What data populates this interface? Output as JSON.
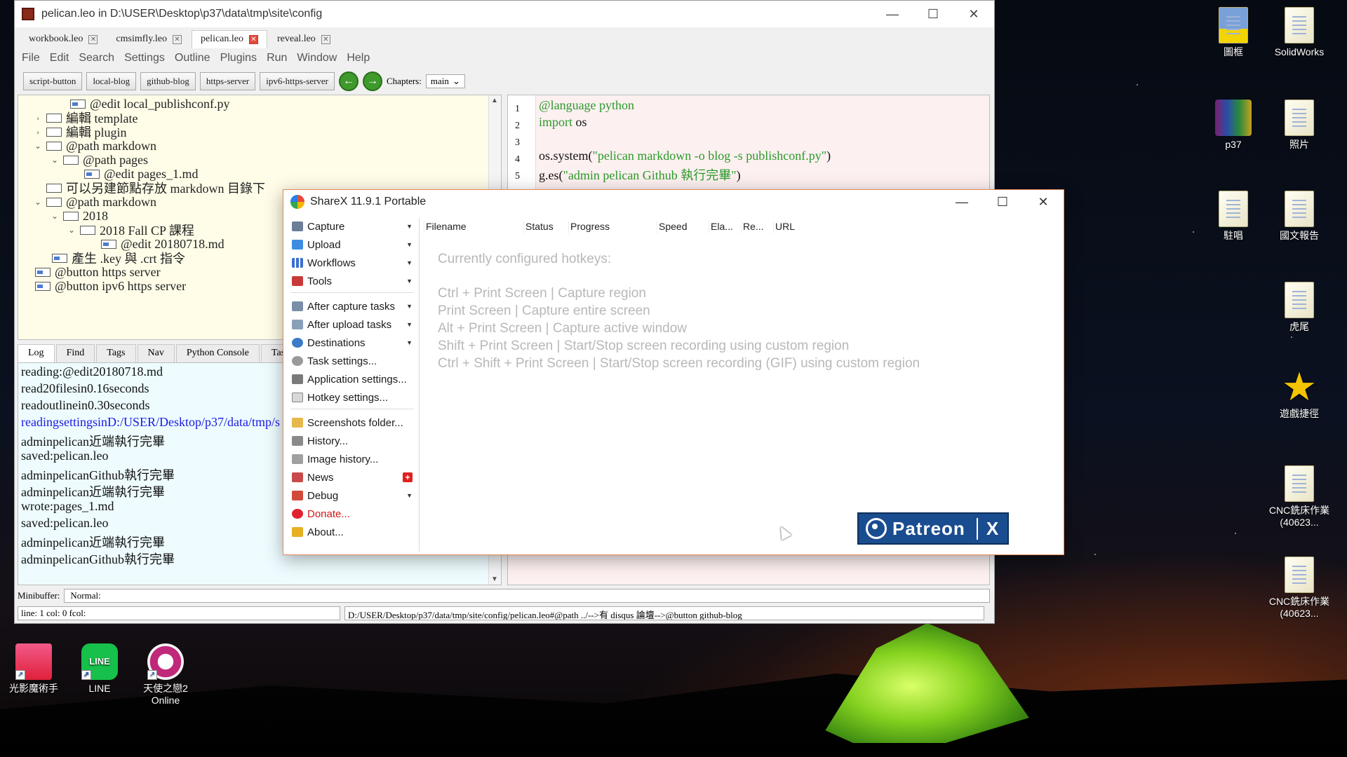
{
  "desktop": {
    "icons": [
      {
        "label": "圖框",
        "icon": "dwg-file-icon"
      },
      {
        "label": "SolidWorks",
        "icon": "document-icon"
      },
      {
        "label": "p37",
        "icon": "winrar-archive-icon"
      },
      {
        "label": "照片",
        "icon": "document-icon"
      },
      {
        "label": "駐唱",
        "icon": "document-icon"
      },
      {
        "label": "國文報告",
        "icon": "document-icon"
      },
      {
        "label": "虎尾",
        "icon": "document-icon"
      },
      {
        "label": "遊戲捷徑",
        "icon": "star-icon"
      },
      {
        "label": "CNC銑床作業(40623...",
        "icon": "document-icon"
      },
      {
        "label": "CNC銑床作業(40623...",
        "icon": "document-icon"
      },
      {
        "label": "光影魔術手",
        "icon": "photo-app-icon"
      },
      {
        "label": "LINE",
        "icon": "line-app-icon"
      },
      {
        "label": "天使之戀2 Online",
        "icon": "game-app-icon"
      }
    ]
  },
  "leo": {
    "title": "pelican.leo in D:\\USER\\Desktop\\p37\\data\\tmp\\site\\config",
    "tabs": [
      "workbook.leo",
      "cmsimfly.leo",
      "pelican.leo",
      "reveal.leo"
    ],
    "menu": [
      "File",
      "Edit",
      "Search",
      "Settings",
      "Outline",
      "Plugins",
      "Run",
      "Window",
      "Help"
    ],
    "toolbar_buttons": [
      "script-button",
      "local-blog",
      "github-blog",
      "https-server",
      "ipv6-https-server"
    ],
    "chapters_label": "Chapters:",
    "chapters_value": "main",
    "outline": [
      "@edit local_publishconf.py",
      "編輯 template",
      "編輯 plugin",
      "@path markdown",
      "@path pages",
      "@edit pages_1.md",
      "可以另建節點存放 markdown 目錄下",
      "@path markdown",
      "2018",
      "2018 Fall CP 課程",
      "@edit 20180718.md",
      "產生 .key 與 .crt 指令",
      "@button https server",
      "@button ipv6 https server"
    ],
    "body_lines": [
      {
        "no": "1",
        "text": "@language python"
      },
      {
        "no": "2",
        "text_kw": "import",
        "text_rest": " os"
      },
      {
        "no": "3",
        "text": ""
      },
      {
        "no": "4",
        "text_pre": "os.system(",
        "text_str": "\"pelican markdown -o blog -s publishconf.py\"",
        "text_post": ")"
      },
      {
        "no": "5",
        "text_pre": "g.es(",
        "text_str": "\"admin pelican Github 執行完畢\"",
        "text_post": ")"
      }
    ],
    "log_tabs": [
      "Log",
      "Find",
      "Tags",
      "Nav",
      "Python Console",
      "Task"
    ],
    "log_lines": [
      "reading:@edit20180718.md",
      "read20filesin0.16seconds",
      "readoutlinein0.30seconds",
      "readingsettingsinD:/USER/Desktop/p37/data/tmp/s",
      "adminpelican近端執行完畢",
      "saved:pelican.leo",
      "adminpelicanGithub執行完畢",
      "adminpelican近端執行完畢",
      "wrote:pages_1.md",
      "saved:pelican.leo",
      "adminpelican近端執行完畢",
      "adminpelicanGithub執行完畢"
    ],
    "minibuffer_label": "Minibuffer:",
    "minibuffer_value": "Normal:",
    "status_pos": "line: 1 col: 0 fcol:",
    "status_path": "D:/USER/Desktop/p37/data/tmp/site/config/pelican.leo#@path ../-->有 disqus 論壇-->@button github-blog"
  },
  "sharex": {
    "title": "ShareX 11.9.1 Portable",
    "menu": [
      {
        "label": "Capture",
        "sub": true,
        "icon": "capture-icon"
      },
      {
        "label": "Upload",
        "sub": true,
        "icon": "upload-arrow-icon"
      },
      {
        "label": "Workflows",
        "sub": true,
        "icon": "workflows-grid-icon"
      },
      {
        "label": "Tools",
        "sub": true,
        "icon": "toolbox-icon"
      },
      {
        "label": "After capture tasks",
        "sub": true,
        "icon": "after-capture-icon"
      },
      {
        "label": "After upload tasks",
        "sub": true,
        "icon": "after-upload-icon"
      },
      {
        "label": "Destinations",
        "sub": true,
        "icon": "globe-icon"
      },
      {
        "label": "Task settings...",
        "sub": false,
        "icon": "gear-icon"
      },
      {
        "label": "Application settings...",
        "sub": false,
        "icon": "wrench-icon"
      },
      {
        "label": "Hotkey settings...",
        "sub": false,
        "icon": "keyboard-icon"
      },
      {
        "label": "Screenshots folder...",
        "sub": false,
        "icon": "folder-icon"
      },
      {
        "label": "History...",
        "sub": false,
        "icon": "history-icon"
      },
      {
        "label": "Image history...",
        "sub": false,
        "icon": "image-history-icon"
      },
      {
        "label": "News",
        "sub": false,
        "icon": "megaphone-icon",
        "badge": "+"
      },
      {
        "label": "Debug",
        "sub": true,
        "icon": "debug-icon"
      },
      {
        "label": "Donate...",
        "sub": false,
        "icon": "heart-icon"
      },
      {
        "label": "About...",
        "sub": false,
        "icon": "crown-icon"
      }
    ],
    "columns": [
      "Filename",
      "Status",
      "Progress",
      "Speed",
      "Ela...",
      "Re...",
      "URL"
    ],
    "hotkeys_title": "Currently configured hotkeys:",
    "hotkeys": [
      "Ctrl + Print Screen  |  Capture region",
      "Print Screen  |  Capture entire screen",
      "Alt + Print Screen  |  Capture active window",
      "Shift + Print Screen  |  Start/Stop screen recording using custom region",
      "Ctrl + Shift + Print Screen  |  Start/Stop screen recording (GIF) using custom region"
    ],
    "patreon_label": "Patreon",
    "patreon_close": "X"
  },
  "colors": {
    "leo_outline_bg": "#fffde8",
    "leo_body_bg": "#fdf0f0",
    "leo_log_bg": "#eefcff",
    "code_green": "#2a9a2a",
    "log_blue": "#1a1ae0",
    "patreon_blue": "#1a4d8f"
  }
}
